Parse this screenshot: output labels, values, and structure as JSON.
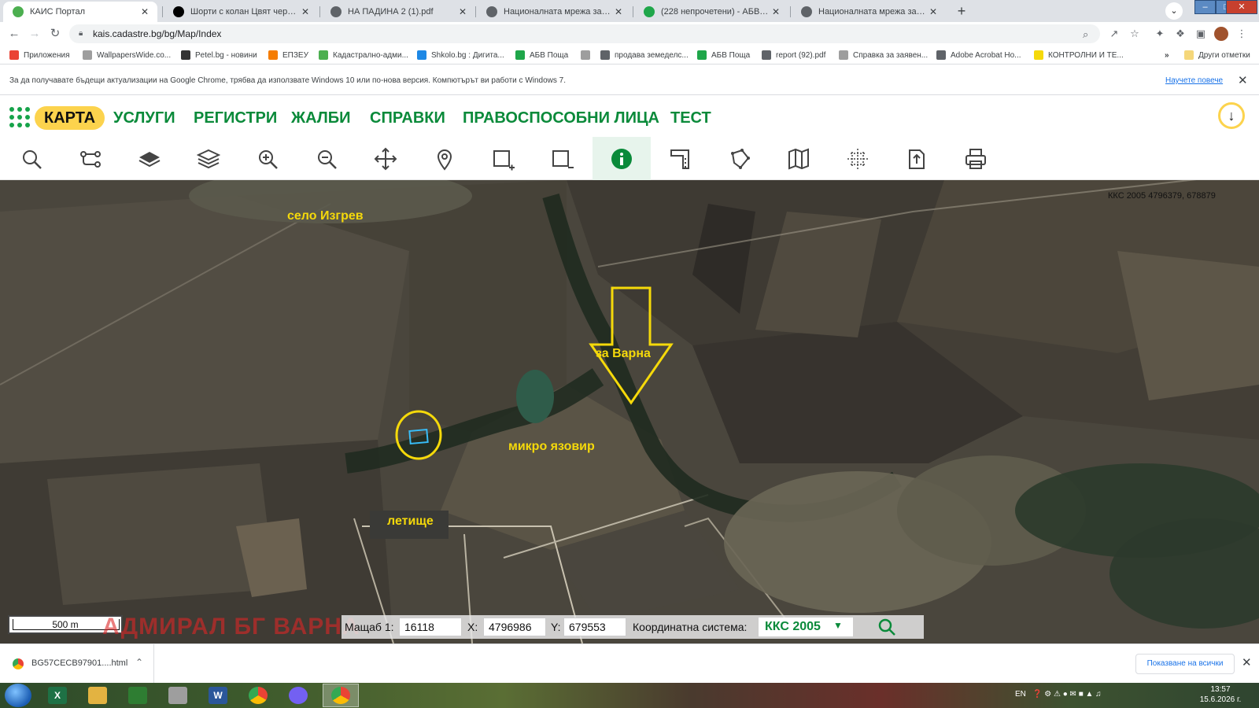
{
  "browser": {
    "tabs": [
      {
        "title": "КАИС Портал",
        "favicon_color": "#4caf50",
        "active": true
      },
      {
        "title": "Шорти с колан Цвят червен - М",
        "favicon_color": "#000000",
        "active": false
      },
      {
        "title": "НА ПАДИНА 2 (1).pdf",
        "favicon_color": "#5f6368",
        "active": false
      },
      {
        "title": "Националната мрежа за земед",
        "favicon_color": "#5f6368",
        "active": false
      },
      {
        "title": "(228 непрочетени) - АБВ поща",
        "favicon_color": "#1fa64a",
        "active": false
      },
      {
        "title": "Националната мрежа за земед",
        "favicon_color": "#5f6368",
        "active": false
      }
    ],
    "url": "kais.cadastre.bg/bg/Map/Index",
    "bookmarks": [
      {
        "label": "Приложения",
        "icon_color": "#ea4335"
      },
      {
        "label": "WallpapersWide.co...",
        "icon_color": "#9e9e9e"
      },
      {
        "label": "Petel.bg - новини",
        "icon_color": "#333333"
      },
      {
        "label": "ЕПЗЕУ",
        "icon_color": "#f57c00"
      },
      {
        "label": "Кадастрално-адми...",
        "icon_color": "#4caf50"
      },
      {
        "label": "Shkolo.bg : Дигита...",
        "icon_color": "#1e88e5"
      },
      {
        "label": "АБВ Поща",
        "icon_color": "#1fa64a"
      },
      {
        "label": "",
        "icon_color": "#9e9e9e"
      },
      {
        "label": "продава земеделс...",
        "icon_color": "#5f6368"
      },
      {
        "label": "АБВ Поща",
        "icon_color": "#1fa64a"
      },
      {
        "label": "report (92).pdf",
        "icon_color": "#5f6368"
      },
      {
        "label": "Справка за заявен...",
        "icon_color": "#9e9e9e"
      },
      {
        "label": "Adobe Acrobat Ho...",
        "icon_color": "#5f6368"
      },
      {
        "label": "КОНТРОЛНИ И ТЕ...",
        "icon_color": "#f5d90a"
      }
    ],
    "bookmarks_more": "»",
    "other_bookmarks": "Други отметки",
    "infobar": {
      "message": "За да получавате бъдещи актуализации на Google Chrome, трябва да използвате Windows 10 или по-нова версия. Компютърът ви работи с Windows 7.",
      "link": "Научете повече"
    }
  },
  "app": {
    "menu": [
      {
        "label": "КАРТА",
        "active": true
      },
      {
        "label": "УСЛУГИ",
        "active": false
      },
      {
        "label": "РЕГИСТРИ",
        "active": false
      },
      {
        "label": "ЖАЛБИ",
        "active": false
      },
      {
        "label": "СПРАВКИ",
        "active": false
      },
      {
        "label": "ПРАВОСПОСОБНИ ЛИЦА",
        "active": false
      },
      {
        "label": "ТЕСТ",
        "active": false
      }
    ],
    "tools": [
      {
        "name": "search-icon",
        "active": false
      },
      {
        "name": "route-icon",
        "active": false
      },
      {
        "name": "layer-icon",
        "active": false
      },
      {
        "name": "layers-icon",
        "active": false
      },
      {
        "name": "zoom-in-icon",
        "active": false
      },
      {
        "name": "zoom-out-icon",
        "active": false
      },
      {
        "name": "pan-icon",
        "active": false
      },
      {
        "name": "location-pin-icon",
        "active": false
      },
      {
        "name": "add-frame-icon",
        "active": false
      },
      {
        "name": "remove-frame-icon",
        "active": false
      },
      {
        "name": "info-icon",
        "active": true
      },
      {
        "name": "measure-icon",
        "active": false
      },
      {
        "name": "polygon-icon",
        "active": false
      },
      {
        "name": "map-icon",
        "active": false
      },
      {
        "name": "coordinate-grid-icon",
        "active": false
      },
      {
        "name": "export-icon",
        "active": false
      },
      {
        "name": "print-icon",
        "active": false
      }
    ],
    "brand_color": "#0a8a3a",
    "accent_color": "#fcd34d"
  },
  "map": {
    "coordinates_readout": "ККС 2005 4796379, 678879",
    "labels": {
      "village": "село Изгрев",
      "to_varna": "за Варна",
      "reservoir": "микро язовир",
      "airfield": "летище"
    },
    "annotation_color": "#f5d90a",
    "parcel_color": "#38bdf8",
    "scale_bar": "500 m",
    "watermark": "АДМИРАЛ БГ ВАРНА",
    "scale_label": "Мащаб 1:",
    "scale_value": "16118",
    "x_label": "X:",
    "x_value": "4796986",
    "y_label": "Y:",
    "y_value": "679553",
    "crs_label": "Координатна система:",
    "crs_value": "ККС 2005"
  },
  "downloads": {
    "file": "BG57CECB97901....html",
    "show_all": "Показване на всички"
  },
  "taskbar": {
    "apps": [
      {
        "name": "excel-icon",
        "color": "#1e7145",
        "glyph": "X",
        "active": false
      },
      {
        "name": "explorer-icon",
        "color": "#e3b341",
        "glyph": "",
        "active": false
      },
      {
        "name": "calculator-icon",
        "color": "#2e7d32",
        "glyph": "",
        "active": false
      },
      {
        "name": "paint-icon",
        "color": "#9e9e9e",
        "glyph": "",
        "active": false
      },
      {
        "name": "word-icon",
        "color": "#2b579a",
        "glyph": "W",
        "active": false
      },
      {
        "name": "chrome-icon",
        "color": "#34a853",
        "glyph": "",
        "active": false
      },
      {
        "name": "viber-icon",
        "color": "#7360f2",
        "glyph": "",
        "active": false
      },
      {
        "name": "chrome-icon",
        "color": "#34a853",
        "glyph": "",
        "active": true
      }
    ],
    "language": "EN",
    "time": "13:57",
    "date": "15.6.2026 г."
  }
}
